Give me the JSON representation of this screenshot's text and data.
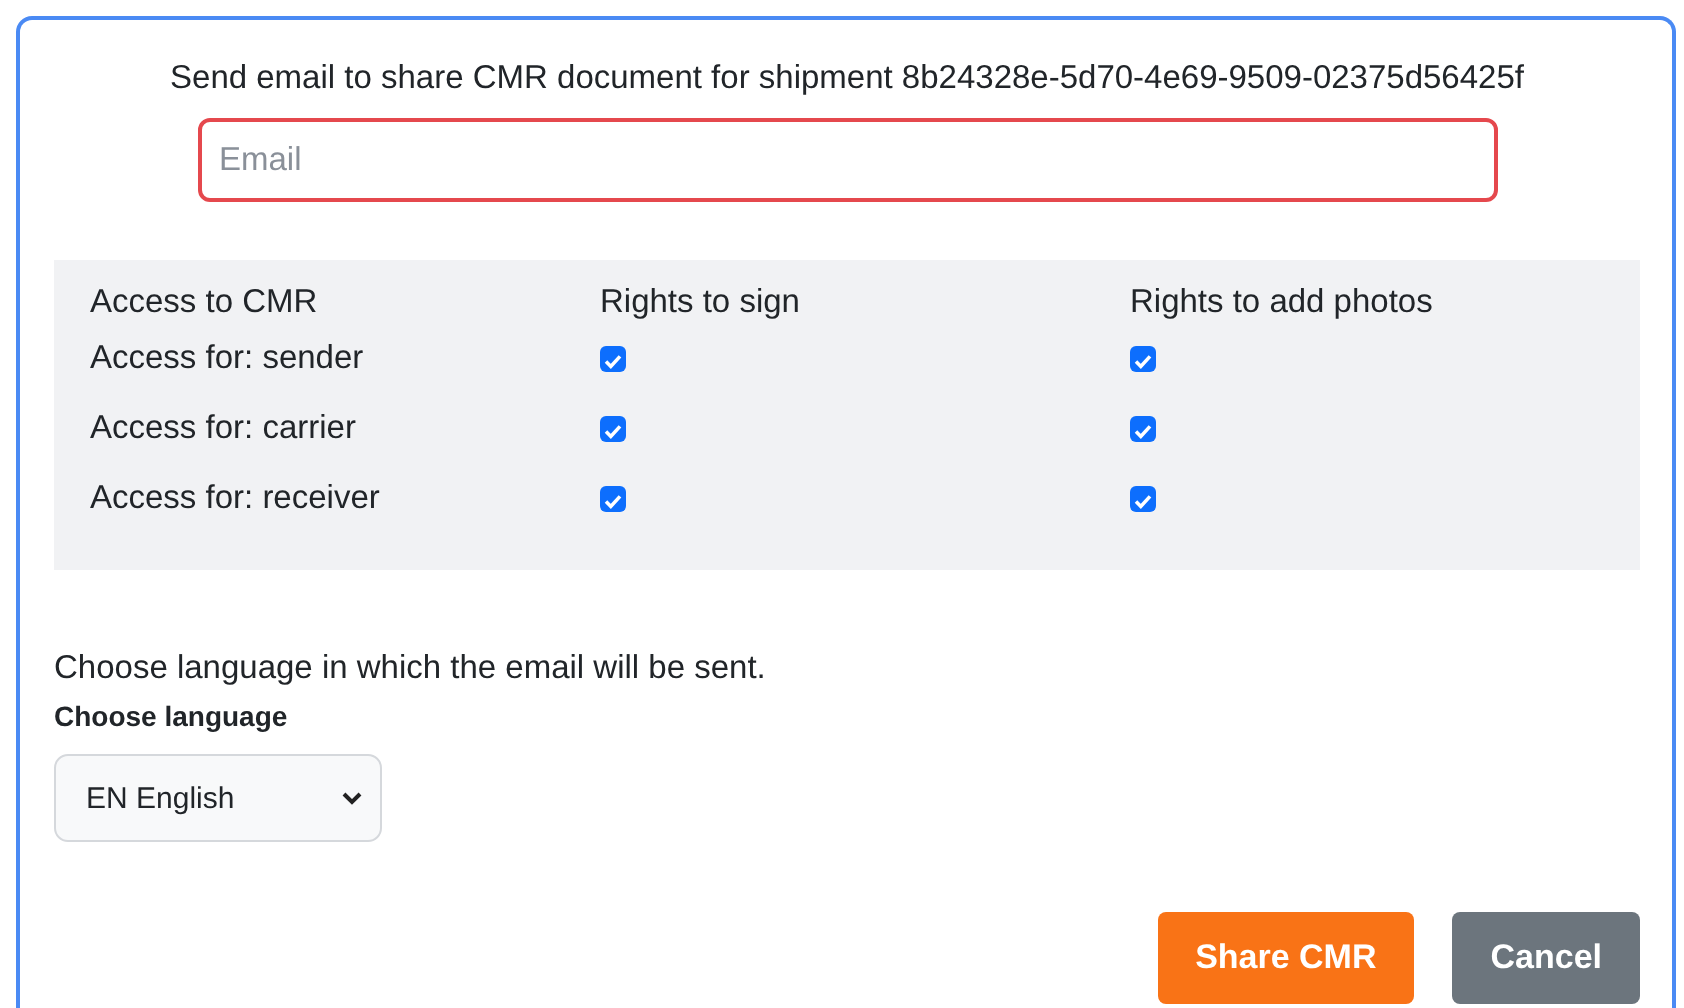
{
  "dialog": {
    "title": "Send email to share CMR document for shipment 8b24328e-5d70-4e69-9509-02375d56425f",
    "email": {
      "placeholder": "Email",
      "invalid": true
    },
    "access_table": {
      "columns": [
        "Access to CMR",
        "Rights to sign",
        "Rights to add photos"
      ],
      "rows": [
        {
          "label": "Access for: sender",
          "sign": true,
          "photos": true
        },
        {
          "label": "Access for: carrier",
          "sign": true,
          "photos": true
        },
        {
          "label": "Access for: receiver",
          "sign": true,
          "photos": true
        }
      ]
    },
    "language": {
      "description": "Choose language in which the email will be sent.",
      "label": "Choose language",
      "value": "EN English"
    },
    "buttons": [
      {
        "label": "Share CMR",
        "kind": "primary"
      },
      {
        "label": "Cancel",
        "kind": "secondary"
      }
    ]
  }
}
